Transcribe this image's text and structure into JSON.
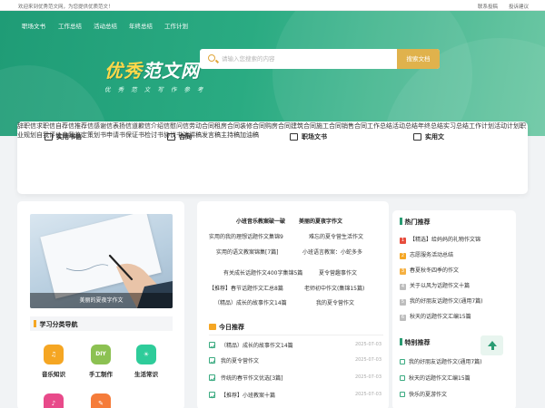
{
  "topbar": {
    "welcome": "欢迎来到优秀范文网，为您提供优质范文！",
    "links": [
      "联系投稿",
      "投诉建议"
    ]
  },
  "nav": [
    "职场文书",
    "工作总结",
    "活动总结",
    "年终总结",
    "工作计划"
  ],
  "logo": {
    "main_a": "优秀",
    "main_b": "范文网",
    "sub": "优 秀 范 文 写 作 参 考"
  },
  "search": {
    "placeholder": "请输入您搜索的内容",
    "button": "搜索文档"
  },
  "categories": [
    {
      "title": "实用书信",
      "icon": "mail-icon",
      "links": [
        "辞职信",
        "求职信",
        "自荐信",
        "推荐信",
        "感谢信",
        "表扬信",
        "道歉信",
        "介绍信",
        "慰问信"
      ]
    },
    {
      "title": "合同",
      "icon": "contract-icon",
      "links": [
        "劳动合同",
        "租房合同",
        "装修合同",
        "购房合同",
        "建筑合同",
        "施工合同",
        "销售合同"
      ]
    },
    {
      "title": "职场文书",
      "icon": "document-icon",
      "links": [
        "工作总结",
        "活动总结",
        "年终总结",
        "实习总结",
        "工作计划",
        "活动计划",
        "职业规划",
        "自我评价",
        "自我鉴定"
      ]
    },
    {
      "title": "实用文",
      "icon": "folder-icon",
      "links": [
        "策划书",
        "申请书",
        "保证书",
        "检讨书",
        "协议书",
        "演讲稿",
        "发言稿",
        "主持稿",
        "加油稿"
      ]
    }
  ],
  "featured": {
    "caption": "美丽的夏夜字作文"
  },
  "tools": {
    "title": "学习分类导航",
    "items": [
      {
        "label": "音乐知识",
        "glyph": "♫",
        "color": "#f5a623"
      },
      {
        "label": "手工制作",
        "glyph": "DIY",
        "color": "#8cc152"
      },
      {
        "label": "生活常识",
        "glyph": "☀",
        "color": "#2ecc9a"
      },
      {
        "label": "",
        "glyph": "♪",
        "color": "#e84a8a"
      },
      {
        "label": "",
        "glyph": "✎",
        "color": "#f57c3a"
      }
    ]
  },
  "center": {
    "articles": [
      "小班音乐教案破一破",
      "美丽的夏夜字作文",
      "实用的我的理想话题作文集锦9",
      "难忘的夏令营生活作文",
      "实用的语文教案锦集[7篇]",
      "小班语言教案：小蛇多多",
      "有关成长话题作文400字集锦5篇",
      "夏令营趣事作文",
      "【推荐】春节话题作文汇总8篇",
      "老师初中作文(集锦15篇)",
      "（精品）成长的故事作文14篇",
      "我的夏令营作文"
    ],
    "today_title": "今日推荐",
    "today": [
      {
        "title": "（精品）成长的故事作文14篇",
        "date": "2025-07-03"
      },
      {
        "title": "我的夏令营作文",
        "date": "2025-07-03"
      },
      {
        "title": "传统的春节作文优选[3篇]",
        "date": "2025-07-03"
      },
      {
        "title": "【推荐】小班教案十篇",
        "date": "2025-07-03"
      }
    ]
  },
  "hot": {
    "title": "热门推荐",
    "items": [
      {
        "text": "【精选】给妈妈的礼物作文锦",
        "color": "#e74c3c"
      },
      {
        "text": "志愿服务活动总结",
        "color": "#f5a623"
      },
      {
        "text": "春夏秋冬四季的作文",
        "color": "#f5b041"
      },
      {
        "text": "关于以风为话题作文十篇",
        "color": "#bdbdbd"
      },
      {
        "text": "我的好朋友话题作文(通用7篇)",
        "color": "#bdbdbd"
      },
      {
        "text": "秋天的话题作文汇编15篇",
        "color": "#bdbdbd"
      }
    ]
  },
  "special": {
    "title": "特别推荐",
    "items": [
      "我的好朋友话题作文(通用7篇)",
      "秋天的话题作文汇编15篇",
      "快乐的夏游作文"
    ]
  },
  "colors": {
    "brand": "#2aab82",
    "accent": "#e0b24c"
  }
}
